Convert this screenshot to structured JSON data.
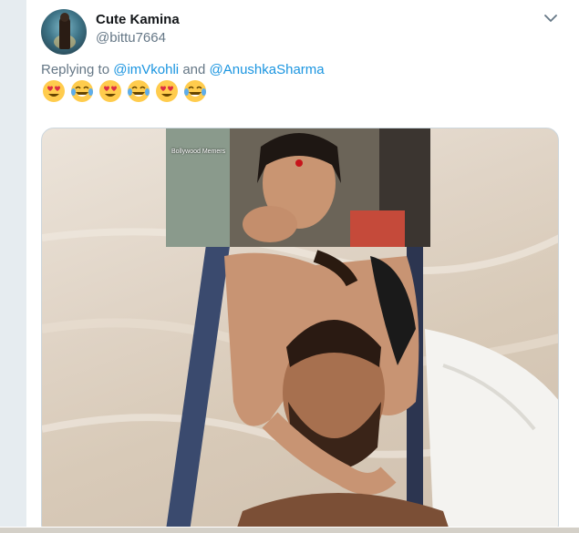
{
  "tweet": {
    "author": {
      "name": "Cute Kamina",
      "handle": "@bittu7664"
    },
    "reply": {
      "prefix": "Replying to",
      "mention1": "@imVkohli",
      "conjunction": "and",
      "mention2": "@AnushkaSharma"
    },
    "emojis": [
      "heart-eyes-emoji",
      "tears-of-joy-emoji",
      "heart-eyes-emoji",
      "tears-of-joy-emoji",
      "heart-eyes-emoji",
      "tears-of-joy-emoji"
    ],
    "media": {
      "watermark": "Bollywood Memers"
    }
  },
  "icons": {
    "caret": "chevron-down-icon"
  },
  "colors": {
    "link": "#1b95e0",
    "secondary_text": "#657786",
    "primary_text": "#14171a"
  }
}
